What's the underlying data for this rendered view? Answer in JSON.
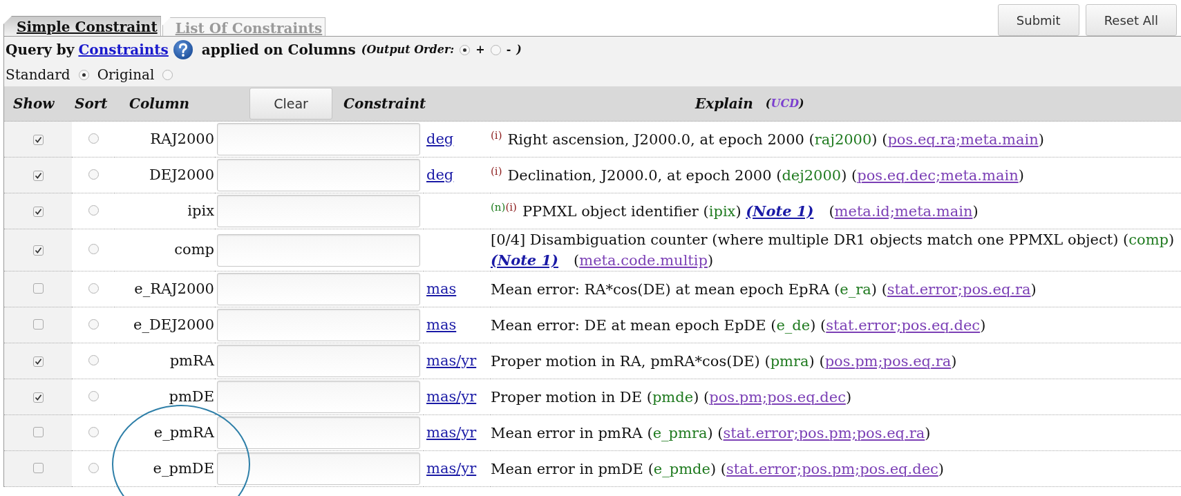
{
  "tabs": [
    {
      "label": "Simple Constraint",
      "selected": true
    },
    {
      "label": "List Of Constraints",
      "selected": false
    }
  ],
  "buttons": [
    "Submit",
    "Reset All"
  ],
  "query": {
    "prefix": "Query by",
    "link": "Constraints",
    "suffix": "applied on Columns",
    "order_label": "(Output Order:",
    "order_options": [
      {
        "label": "+",
        "selected": true
      },
      {
        "label": "-",
        "selected": false
      }
    ],
    "order_close": ")"
  },
  "unit_modes": [
    {
      "label": "Standard",
      "selected": true
    },
    {
      "label": "Original",
      "selected": false
    }
  ],
  "header": {
    "show": "Show",
    "sort": "Sort",
    "column": "Column",
    "clear": "Clear",
    "constraint": "Constraint",
    "explain": "Explain",
    "ucd_open": "(",
    "ucd": "UCD",
    "ucd_close": ")"
  },
  "rows": [
    {
      "name": "RAJ2000",
      "show": true,
      "sort": false,
      "unit": "deg",
      "explain": [
        {
          "kind": "flag",
          "text": "(i)",
          "color": "#8b1a1a"
        },
        {
          "kind": "text",
          "text": "Right ascension, J2000.0, at epoch 2000 ("
        },
        {
          "kind": "colname",
          "text": "raj2000"
        },
        {
          "kind": "text",
          "text": ") ("
        },
        {
          "kind": "ucd",
          "text": "pos.eq.ra;meta.main"
        },
        {
          "kind": "text",
          "text": ")"
        }
      ]
    },
    {
      "name": "DEJ2000",
      "show": true,
      "sort": false,
      "unit": "deg",
      "explain": [
        {
          "kind": "flag",
          "text": "(i)",
          "color": "#8b1a1a"
        },
        {
          "kind": "text",
          "text": "Declination, J2000.0, at epoch 2000 ("
        },
        {
          "kind": "colname",
          "text": "dej2000"
        },
        {
          "kind": "text",
          "text": ") ("
        },
        {
          "kind": "ucd",
          "text": "pos.eq.dec;meta.main"
        },
        {
          "kind": "text",
          "text": ")"
        }
      ]
    },
    {
      "name": "ipix",
      "show": true,
      "sort": false,
      "explain": [
        {
          "kind": "flag",
          "text": "(n)",
          "color": "#1a7a1a"
        },
        {
          "kind": "flag",
          "text": "(i)",
          "color": "#8b1a1a"
        },
        {
          "kind": "text",
          "text": "PPMXL object identifier ("
        },
        {
          "kind": "colname",
          "text": "ipix"
        },
        {
          "kind": "text",
          "text": ") "
        },
        {
          "kind": "note",
          "text": "(Note 1)"
        },
        {
          "kind": "text",
          "text": "("
        },
        {
          "kind": "ucd",
          "text": "meta.id;meta.main"
        },
        {
          "kind": "text",
          "text": ")"
        }
      ]
    },
    {
      "name": "comp",
      "show": true,
      "sort": false,
      "explain": [
        {
          "kind": "text",
          "text": "[0/4] Disambiguation counter (where multiple DR1 objects match one PPMXL object) ("
        },
        {
          "kind": "colname",
          "text": "comp"
        },
        {
          "kind": "text",
          "text": ") "
        },
        {
          "kind": "note",
          "text": "(Note 1)"
        },
        {
          "kind": "text",
          "text": "("
        },
        {
          "kind": "ucd",
          "text": "meta.code.multip"
        },
        {
          "kind": "text",
          "text": ")"
        }
      ]
    },
    {
      "name": "e_RAJ2000",
      "show": false,
      "sort": false,
      "unit": "mas",
      "explain": [
        {
          "kind": "text",
          "text": "Mean error: RA*cos(DE) at mean epoch EpRA ("
        },
        {
          "kind": "colname",
          "text": "e_ra"
        },
        {
          "kind": "text",
          "text": ") ("
        },
        {
          "kind": "ucd",
          "text": "stat.error;pos.eq.ra"
        },
        {
          "kind": "text",
          "text": ")"
        }
      ]
    },
    {
      "name": "e_DEJ2000",
      "show": false,
      "sort": false,
      "unit": "mas",
      "explain": [
        {
          "kind": "text",
          "text": "Mean error: DE at mean epoch EpDE ("
        },
        {
          "kind": "colname",
          "text": "e_de"
        },
        {
          "kind": "text",
          "text": ") ("
        },
        {
          "kind": "ucd",
          "text": "stat.error;pos.eq.dec"
        },
        {
          "kind": "text",
          "text": ")"
        }
      ]
    },
    {
      "name": "pmRA",
      "show": true,
      "sort": false,
      "unit": "mas/yr",
      "explain": [
        {
          "kind": "text",
          "text": "Proper motion in RA, pmRA*cos(DE) ("
        },
        {
          "kind": "colname",
          "text": "pmra"
        },
        {
          "kind": "text",
          "text": ") ("
        },
        {
          "kind": "ucd",
          "text": "pos.pm;pos.eq.ra"
        },
        {
          "kind": "text",
          "text": ")"
        }
      ]
    },
    {
      "name": "pmDE",
      "show": true,
      "sort": false,
      "unit": "mas/yr",
      "explain": [
        {
          "kind": "text",
          "text": "Proper motion in DE ("
        },
        {
          "kind": "colname",
          "text": "pmde"
        },
        {
          "kind": "text",
          "text": ") ("
        },
        {
          "kind": "ucd",
          "text": "pos.pm;pos.eq.dec"
        },
        {
          "kind": "text",
          "text": ")"
        }
      ]
    },
    {
      "name": "e_pmRA",
      "show": false,
      "sort": false,
      "unit": "mas/yr",
      "explain": [
        {
          "kind": "text",
          "text": "Mean error in pmRA ("
        },
        {
          "kind": "colname",
          "text": "e_pmra"
        },
        {
          "kind": "text",
          "text": ") ("
        },
        {
          "kind": "ucd",
          "text": "stat.error;pos.pm;pos.eq.ra"
        },
        {
          "kind": "text",
          "text": ")"
        }
      ]
    },
    {
      "name": "e_pmDE",
      "show": false,
      "sort": false,
      "unit": "mas/yr",
      "explain": [
        {
          "kind": "text",
          "text": "Mean error in pmDE ("
        },
        {
          "kind": "colname",
          "text": "e_pmde"
        },
        {
          "kind": "text",
          "text": ") ("
        },
        {
          "kind": "ucd",
          "text": "stat.error;pos.pm;pos.eq.dec"
        },
        {
          "kind": "text",
          "text": ")"
        }
      ]
    }
  ]
}
